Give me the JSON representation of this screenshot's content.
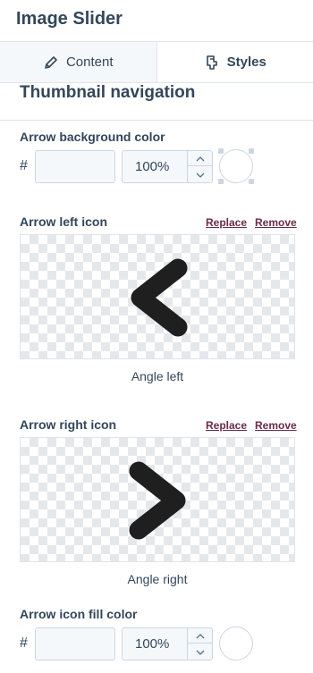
{
  "header": {
    "title": "Image Slider"
  },
  "tabs": [
    {
      "label": "Content",
      "icon": "pencil-icon",
      "active": false
    },
    {
      "label": "Styles",
      "icon": "paint-bucket-icon",
      "active": true
    }
  ],
  "section": {
    "title": "Thumbnail navigation"
  },
  "arrow_background": {
    "label": "Arrow background color",
    "hash": "#",
    "hex_value": "",
    "opacity": "100%",
    "swatch_color": "#ffffff"
  },
  "arrow_left_icon": {
    "label": "Arrow left icon",
    "replace_label": "Replace",
    "remove_label": "Remove",
    "caption": "Angle left",
    "icon": "angle-left-icon"
  },
  "arrow_right_icon": {
    "label": "Arrow right icon",
    "replace_label": "Replace",
    "remove_label": "Remove",
    "caption": "Angle right",
    "icon": "angle-right-icon"
  },
  "arrow_fill": {
    "label": "Arrow icon fill color",
    "hash": "#",
    "hex_value": "",
    "opacity": "100%",
    "swatch_color": "#ffffff"
  },
  "colors": {
    "text": "#33475b",
    "link": "#6b2b4b",
    "border": "#cbd6e2",
    "icon": "#1f1f1f"
  }
}
